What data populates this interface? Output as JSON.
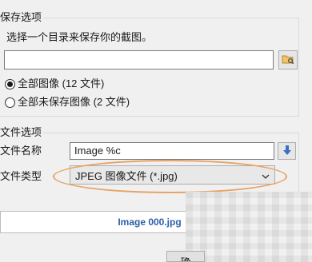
{
  "save_group": {
    "legend": "保存选项",
    "instruction": "选择一个目录来保存你的截图。",
    "path_value": "",
    "browse_icon": "folder-browse-icon",
    "radio_all": "全部图像 (12 文件)",
    "radio_all_checked": true,
    "radio_unsaved": "全部未保存图像 (2 文件)",
    "radio_unsaved_checked": false
  },
  "file_group": {
    "legend": "文件选项",
    "name_label": "文件名称",
    "name_value": "Image %c",
    "insert_icon": "down-arrow-icon",
    "type_label": "文件类型",
    "type_value": "JPEG 图像文件 (*.jpg)",
    "type_arrow": "chevron-down-icon"
  },
  "preview": {
    "filename": "Image 000.jpg"
  },
  "bottom": {
    "button_label": "确"
  },
  "colors": {
    "highlight": "#e8a265",
    "preview_text": "#2f5ea8",
    "insert_arrow": "#3b6fc2"
  }
}
